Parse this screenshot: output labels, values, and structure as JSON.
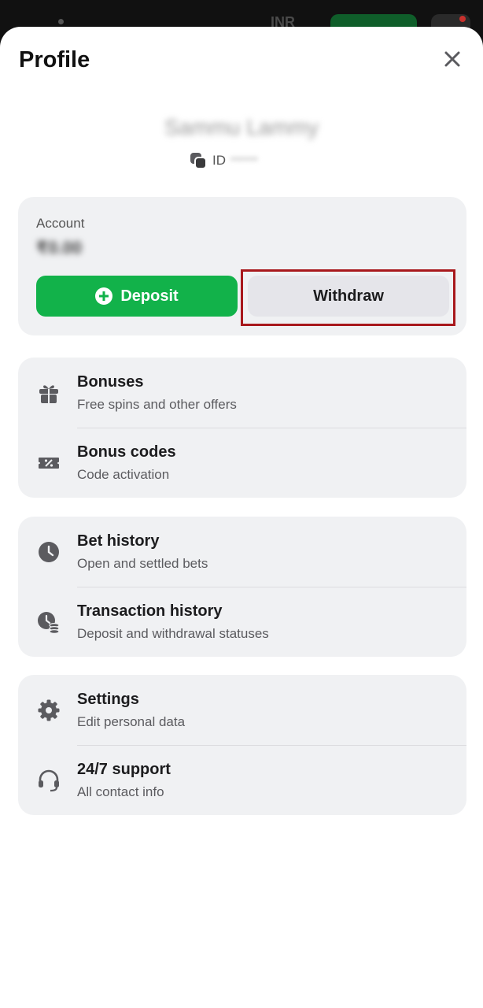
{
  "background": {
    "currency": "INR"
  },
  "header": {
    "title": "Profile"
  },
  "user": {
    "name": "Sammu Lammy",
    "id_label": "ID",
    "id_value": "******"
  },
  "account": {
    "label": "Account",
    "balance": "₹0.00",
    "deposit_label": "Deposit",
    "withdraw_label": "Withdraw"
  },
  "menu": {
    "bonuses": {
      "title": "Bonuses",
      "subtitle": "Free spins and other offers"
    },
    "bonus_codes": {
      "title": "Bonus codes",
      "subtitle": "Code activation"
    },
    "bet_history": {
      "title": "Bet history",
      "subtitle": "Open and settled bets"
    },
    "transaction_history": {
      "title": "Transaction history",
      "subtitle": "Deposit and withdrawal statuses"
    },
    "settings": {
      "title": "Settings",
      "subtitle": "Edit personal data"
    },
    "support": {
      "title": "24/7 support",
      "subtitle": "All contact info"
    }
  },
  "colors": {
    "accent_green": "#12b24a",
    "highlight_red": "#a8181c",
    "card_bg": "#f0f1f3"
  }
}
